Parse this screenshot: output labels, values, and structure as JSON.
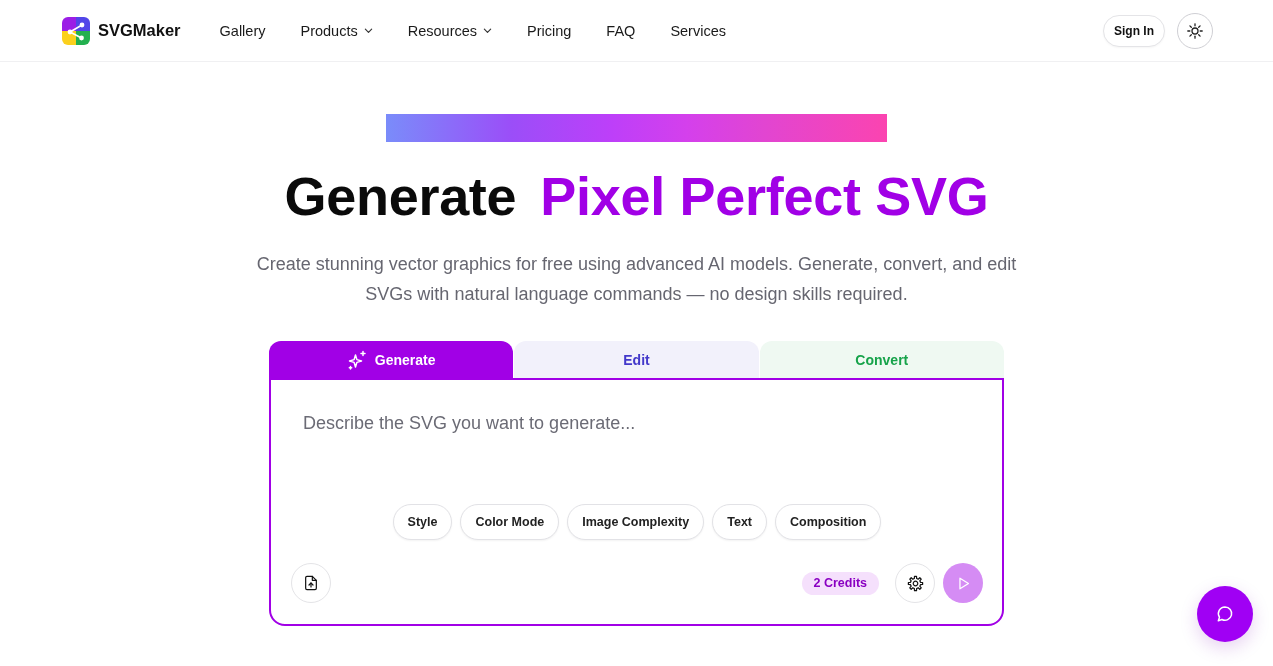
{
  "header": {
    "brand": "SVGMaker",
    "nav": [
      {
        "label": "Gallery",
        "has_menu": false
      },
      {
        "label": "Products",
        "has_menu": true
      },
      {
        "label": "Resources",
        "has_menu": true
      },
      {
        "label": "Pricing",
        "has_menu": false
      },
      {
        "label": "FAQ",
        "has_menu": false
      },
      {
        "label": "Services",
        "has_menu": false
      }
    ],
    "sign_in": "Sign In"
  },
  "hero": {
    "title": "Generate",
    "title_accent": "Pixel Perfect SVG",
    "subtitle": "Create stunning vector graphics for free using advanced AI models. Generate, convert, and edit SVGs with natural language commands — no design skills required."
  },
  "tabs": [
    {
      "label": "Generate",
      "selected": true,
      "has_icon": true,
      "color": "#a100e6"
    },
    {
      "label": "Edit",
      "selected": false,
      "has_icon": false,
      "color": "#4338ca"
    },
    {
      "label": "Convert",
      "selected": false,
      "has_icon": false,
      "color": "#16a34a"
    }
  ],
  "prompt": {
    "placeholder": "Describe the SVG you want to generate..."
  },
  "options": [
    "Style",
    "Color Mode",
    "Image Complexity",
    "Text",
    "Composition"
  ],
  "credits": "2 Credits",
  "send_button": {
    "disabled": true
  }
}
